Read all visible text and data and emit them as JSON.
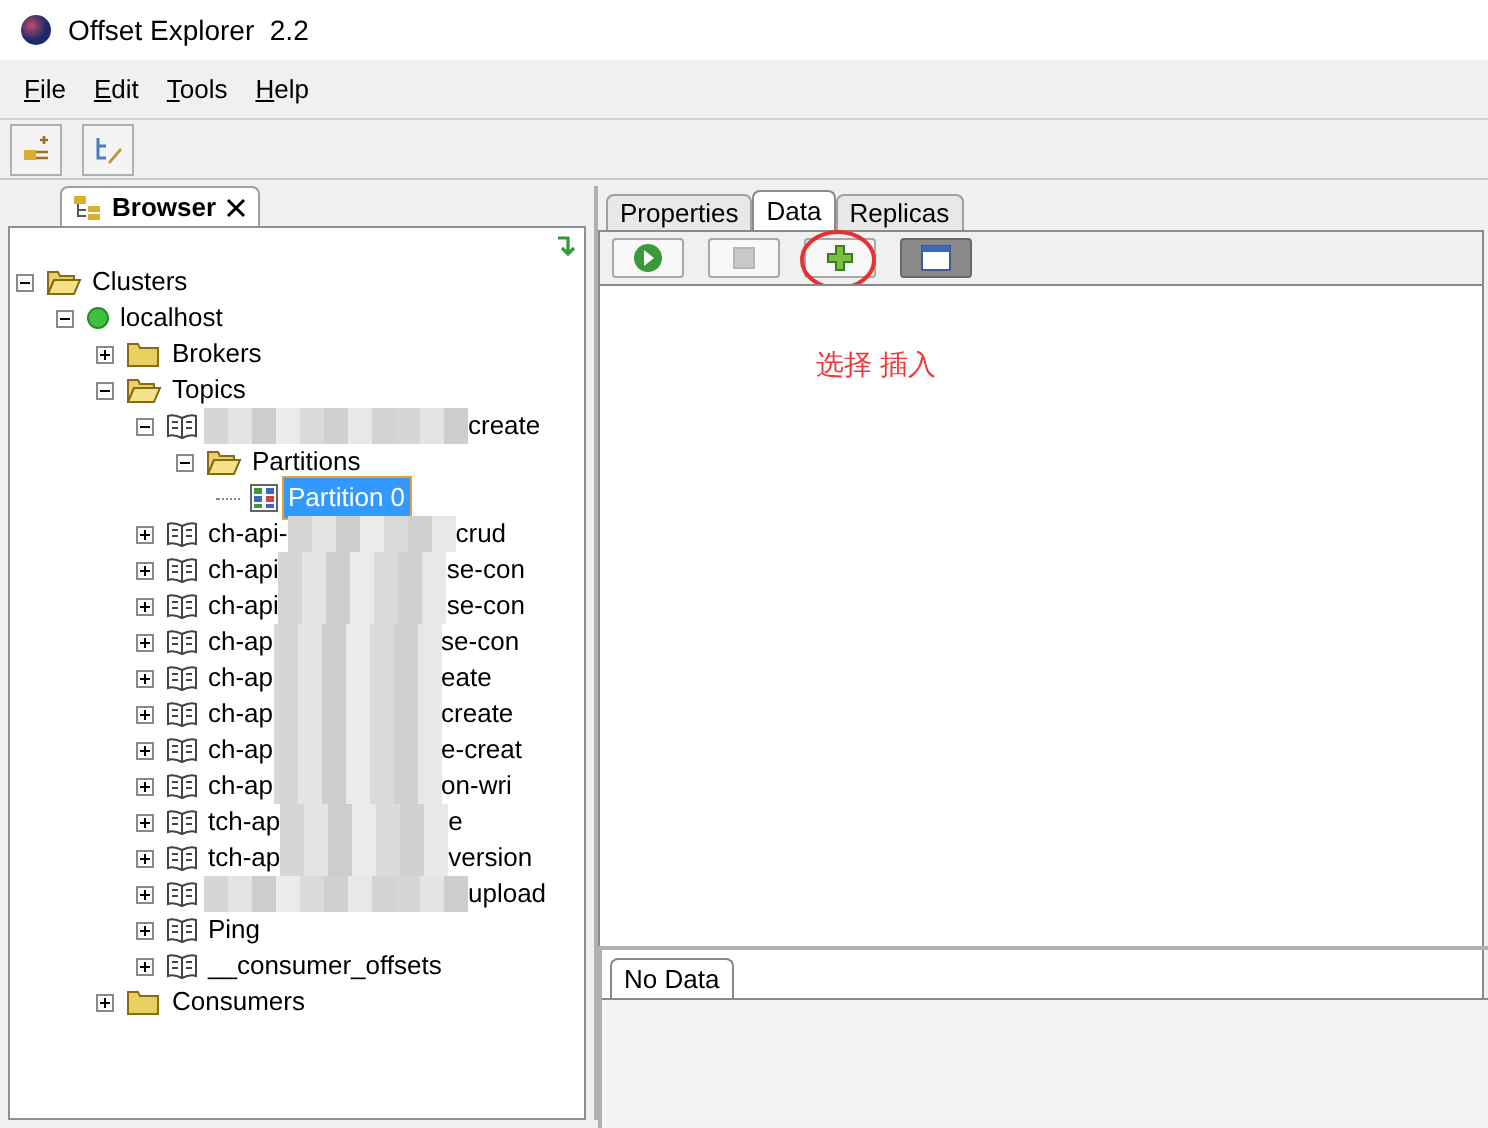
{
  "window": {
    "title": "Offset Explorer  2.2"
  },
  "menu": [
    {
      "label": "File"
    },
    {
      "label": "Edit"
    },
    {
      "label": "Tools"
    },
    {
      "label": "Help"
    }
  ],
  "browser_tab": {
    "label": "Browser"
  },
  "tree": [
    {
      "kind": "folder",
      "label": "Clusters",
      "expanded": true,
      "children": [
        {
          "kind": "server",
          "label": "localhost",
          "expanded": true,
          "children": [
            {
              "kind": "folder",
              "label": "Brokers",
              "expanded": false
            },
            {
              "kind": "folder",
              "label": "Topics",
              "expanded": true,
              "children": [
                {
                  "kind": "topic",
                  "label_end": "create",
                  "expanded": true,
                  "children": [
                    {
                      "kind": "folder",
                      "label": "Partitions",
                      "expanded": true,
                      "children": [
                        {
                          "kind": "partition",
                          "label": "Partition 0",
                          "selected": true
                        }
                      ]
                    }
                  ]
                },
                {
                  "kind": "topic",
                  "label_start": "ch-api-",
                  "label_end": "crud",
                  "expanded": false
                },
                {
                  "kind": "topic",
                  "label_start": "ch-api",
                  "label_end": "se-con",
                  "expanded": false
                },
                {
                  "kind": "topic",
                  "label_start": "ch-api",
                  "label_end": "se-con",
                  "expanded": false
                },
                {
                  "kind": "topic",
                  "label_start": "ch-ap",
                  "label_end": "se-con",
                  "expanded": false
                },
                {
                  "kind": "topic",
                  "label_start": "ch-ap",
                  "label_end": "eate",
                  "expanded": false
                },
                {
                  "kind": "topic",
                  "label_start": "ch-ap",
                  "label_end": "create",
                  "expanded": false
                },
                {
                  "kind": "topic",
                  "label_start": "ch-ap",
                  "label_end": "e-creat",
                  "expanded": false
                },
                {
                  "kind": "topic",
                  "label_start": "ch-ap",
                  "label_end": "on-wri",
                  "expanded": false
                },
                {
                  "kind": "topic",
                  "label_start": "tch-ap",
                  "label_end": "e",
                  "expanded": false
                },
                {
                  "kind": "topic",
                  "label_start": "tch-ap",
                  "label_end": "version",
                  "expanded": false
                },
                {
                  "kind": "topic",
                  "label_end": "upload",
                  "expanded": false
                },
                {
                  "kind": "topic",
                  "label": "Ping",
                  "expanded": false
                },
                {
                  "kind": "topic",
                  "label": "__consumer_offsets",
                  "expanded": false
                }
              ]
            },
            {
              "kind": "folder",
              "label": "Consumers",
              "expanded": false
            }
          ]
        }
      ]
    }
  ],
  "detail_tabs": [
    {
      "label": "Properties",
      "selected": false
    },
    {
      "label": "Data",
      "selected": true
    },
    {
      "label": "Replicas",
      "selected": false
    }
  ],
  "data_toolbar": [
    {
      "kind": "play",
      "disabled": false,
      "pressed": false
    },
    {
      "kind": "stop",
      "disabled": true,
      "pressed": false
    },
    {
      "kind": "add",
      "disabled": false,
      "pressed": false
    },
    {
      "kind": "window",
      "disabled": false,
      "pressed": true
    }
  ],
  "annotation": {
    "text": "选择 插入"
  },
  "bottom_tabs": [
    {
      "label": "No Data",
      "selected": true
    }
  ]
}
